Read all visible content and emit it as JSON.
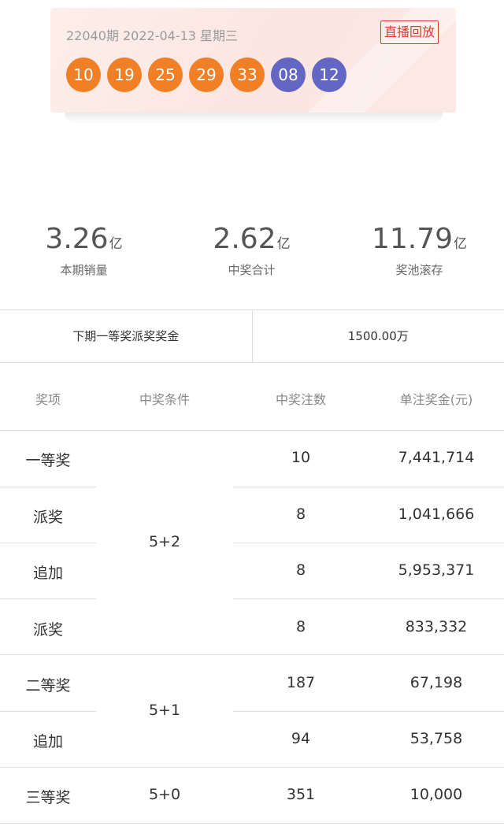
{
  "draw": {
    "issue_text": "22040期 2022-04-13 星期三",
    "replay_label": "直播回放",
    "front_balls": [
      "10",
      "19",
      "25",
      "29",
      "33"
    ],
    "back_balls": [
      "08",
      "12"
    ],
    "colors": {
      "front": "#f07f26",
      "back": "#6366c3",
      "accent": "#e23b2f"
    }
  },
  "stats": [
    {
      "value": "3.26",
      "unit": "亿",
      "label": "本期销量"
    },
    {
      "value": "2.62",
      "unit": "亿",
      "label": "中奖合计"
    },
    {
      "value": "11.79",
      "unit": "亿",
      "label": "奖池滚存"
    }
  ],
  "next_prize": {
    "label": "下期一等奖派奖奖金",
    "value": "1500.00万"
  },
  "table": {
    "headers": [
      "奖项",
      "中奖条件",
      "中奖注数",
      "单注奖金(元)"
    ],
    "rows": [
      {
        "name": "一等奖",
        "count": "10",
        "amount": "7,441,714"
      },
      {
        "name": "派奖",
        "count": "8",
        "amount": "1,041,666"
      },
      {
        "name": "追加",
        "count": "8",
        "amount": "5,953,371"
      },
      {
        "name": "派奖",
        "count": "8",
        "amount": "833,332"
      },
      {
        "name": "二等奖",
        "count": "187",
        "amount": "67,198"
      },
      {
        "name": "追加",
        "count": "94",
        "amount": "53,758"
      },
      {
        "name": "三等奖",
        "count": "351",
        "amount": "10,000"
      }
    ],
    "conditions": [
      "5+2",
      "5+1",
      "5+0"
    ]
  }
}
